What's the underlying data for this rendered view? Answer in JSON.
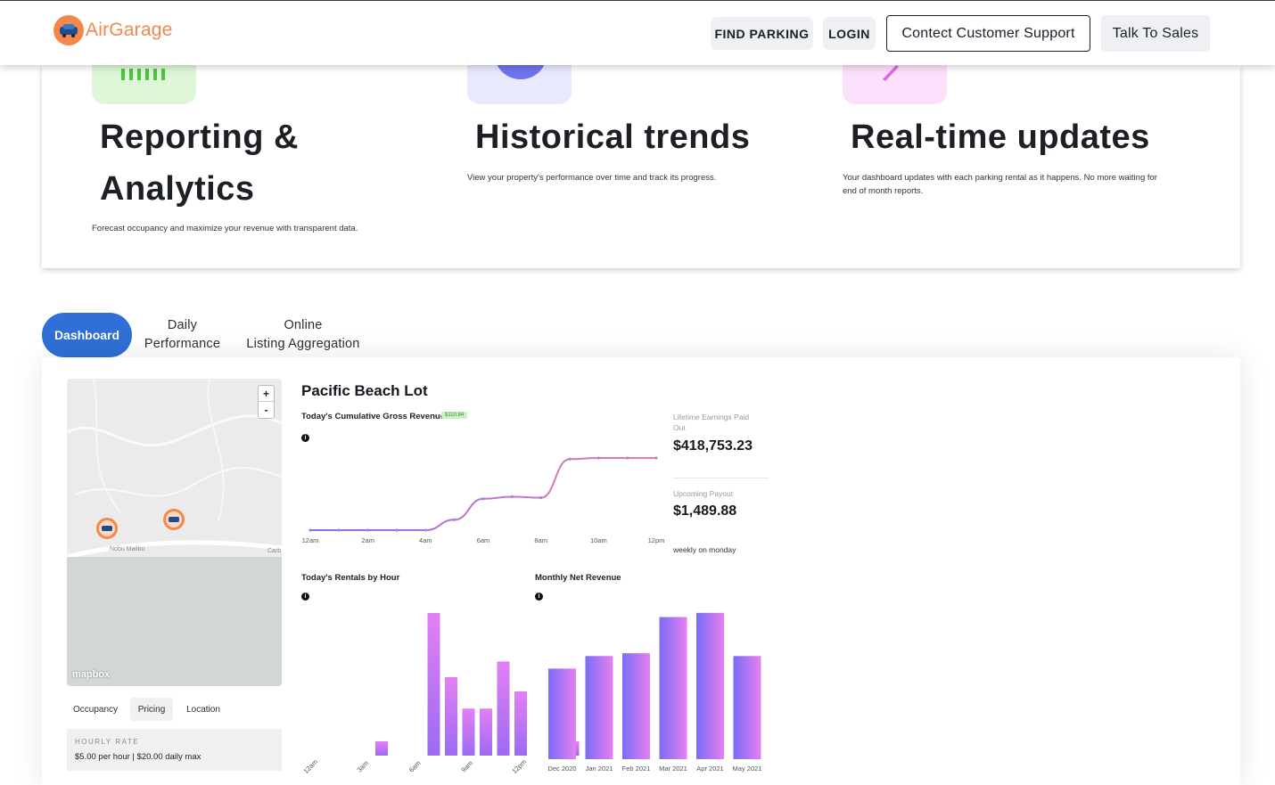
{
  "nav": {
    "logo_text": "AirGarage",
    "find_parking": "FIND PARKING",
    "login": "LOGIN",
    "support": "Contect Customer Support",
    "sales": "Talk To Sales",
    "accent": "#f4874b"
  },
  "features": [
    {
      "title_line1": "Reporting &",
      "title_line2": "Analytics",
      "desc": "Forecast occupancy and maximize your revenue with transparent data."
    },
    {
      "title_line1": "Historical trends",
      "title_line2": "",
      "desc": "View your property's performance over time and track its progress."
    },
    {
      "title_line1": "Real-time updates",
      "title_line2": "",
      "desc_line1": "Your dashboard updates with each parking rental as it happens. No more waiting for",
      "desc_line2": "end of month reports."
    }
  ],
  "tabs": {
    "dashboard": "Dashboard",
    "daily_line1": "Daily",
    "daily_line2": "Performance",
    "online_line1": "Online",
    "online_line2": "Listing Aggregation"
  },
  "map": {
    "zoom_in": "+",
    "zoom_out": "-",
    "attribution": "mapbox",
    "place_label": "Nobu Malibu",
    "place_label_2": "Carb"
  },
  "subtabs": [
    "Occupancy",
    "Pricing",
    "Location"
  ],
  "rate": {
    "label": "HOURLY RATE",
    "value": "$5.00 per hour | $20.00 daily max"
  },
  "dashboard": {
    "lot_name": "Pacific Beach Lot",
    "revenue_title": "Today's Cumulative Gross Revenue",
    "revenue_badge": "$110.84",
    "info_glyph": "i",
    "lifetime_label_1": "Lifetime Earnings Paid",
    "lifetime_label_2": "Out",
    "lifetime_value": "$418,753.23",
    "upcoming_label": "Upcoming Payout",
    "upcoming_value": "$1,489.88",
    "payout_note": "weekly on monday",
    "rentals_title": "Today's Rentals by Hour",
    "monthly_title": "Monthly Net Revenue"
  },
  "chart_data": [
    {
      "type": "line",
      "title": "Today's Cumulative Gross Revenue",
      "x_ticks": [
        "12am",
        "2am",
        "4am",
        "6am",
        "8am",
        "10am",
        "12pm"
      ],
      "x": [
        0,
        1,
        2,
        3,
        4,
        5,
        6,
        7,
        8,
        9,
        10,
        11,
        12
      ],
      "y": [
        0,
        0,
        0,
        0,
        0,
        10,
        30,
        32,
        31,
        68,
        69,
        69,
        69
      ],
      "ylim": [
        0,
        75
      ],
      "grid": false,
      "colors": [
        "#8b6cf5",
        "#f07aa0"
      ]
    },
    {
      "type": "bar",
      "title": "Today's Rentals by Hour",
      "x_ticks": [
        "12am",
        "3am",
        "6am",
        "9am",
        "12pm"
      ],
      "values": [
        0,
        0,
        0,
        0,
        1,
        0,
        0,
        10,
        5.5,
        3.3,
        3.3,
        6.6,
        4.5,
        0,
        0,
        1
      ],
      "ylim": [
        0,
        10.5
      ],
      "colors": [
        "#9b6bf2",
        "#e47ff5"
      ]
    },
    {
      "type": "bar",
      "title": "Monthly Net Revenue",
      "categories": [
        "Dec 2020",
        "Jan 2021",
        "Feb 2021",
        "Mar 2021",
        "Apr 2021",
        "May 2021"
      ],
      "values": [
        65,
        74,
        76,
        102,
        105,
        74
      ],
      "ylim": [
        0,
        110
      ],
      "colors": [
        "#7b6cf6",
        "#e67ff0"
      ]
    }
  ]
}
